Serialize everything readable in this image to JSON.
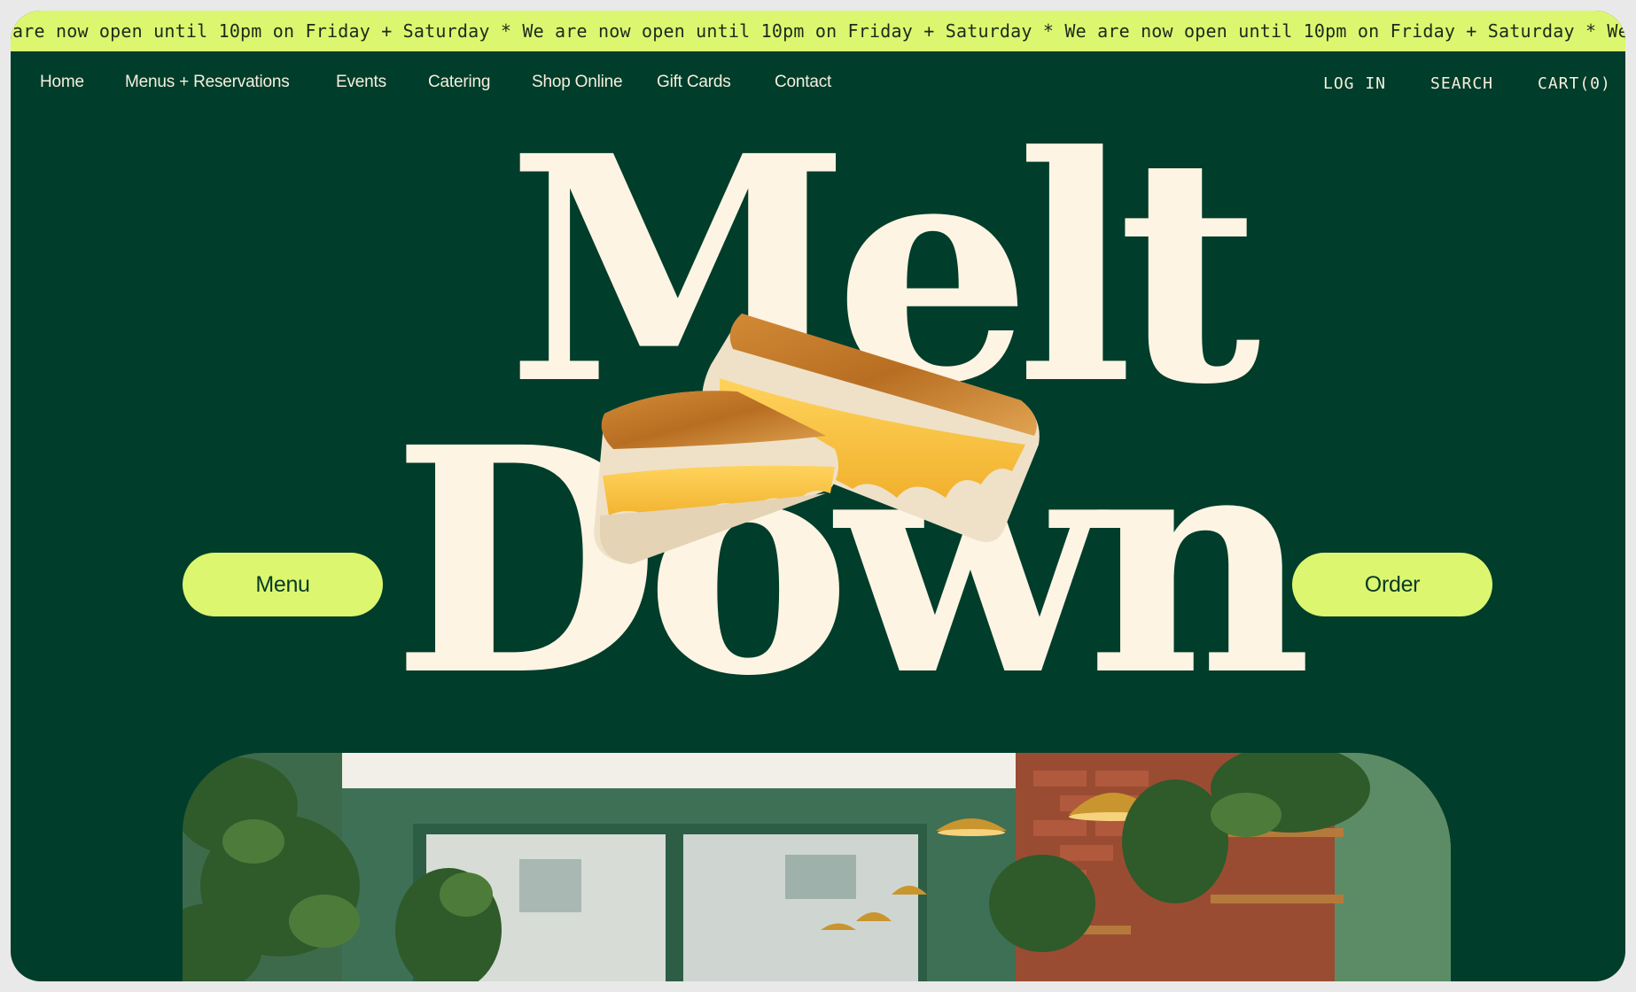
{
  "ticker": {
    "text": "are now open until 10pm on Friday + Saturday * We are now open until 10pm on Friday + Saturday * We are now open until 10pm on Friday + Saturday * We are now"
  },
  "nav": {
    "items": [
      {
        "label": "Home"
      },
      {
        "label": "Menus + Reservations"
      },
      {
        "label": "Events"
      },
      {
        "label": "Catering"
      },
      {
        "label": "Shop Online"
      },
      {
        "label": "Gift Cards"
      },
      {
        "label": "Contact"
      }
    ],
    "login": "LOG IN",
    "search": "SEARCH",
    "cart": "CART(0)"
  },
  "hero": {
    "title_line1": "Melt",
    "title_line2": "Down",
    "menu_button": "Menu",
    "order_button": "Order"
  },
  "colors": {
    "background": "#003d2b",
    "accent": "#dcf76f",
    "title": "#fdf4e3"
  },
  "icons": {
    "sandwich_image": "grilled-cheese-sandwich",
    "photo_image": "cafe-interior-photo"
  }
}
